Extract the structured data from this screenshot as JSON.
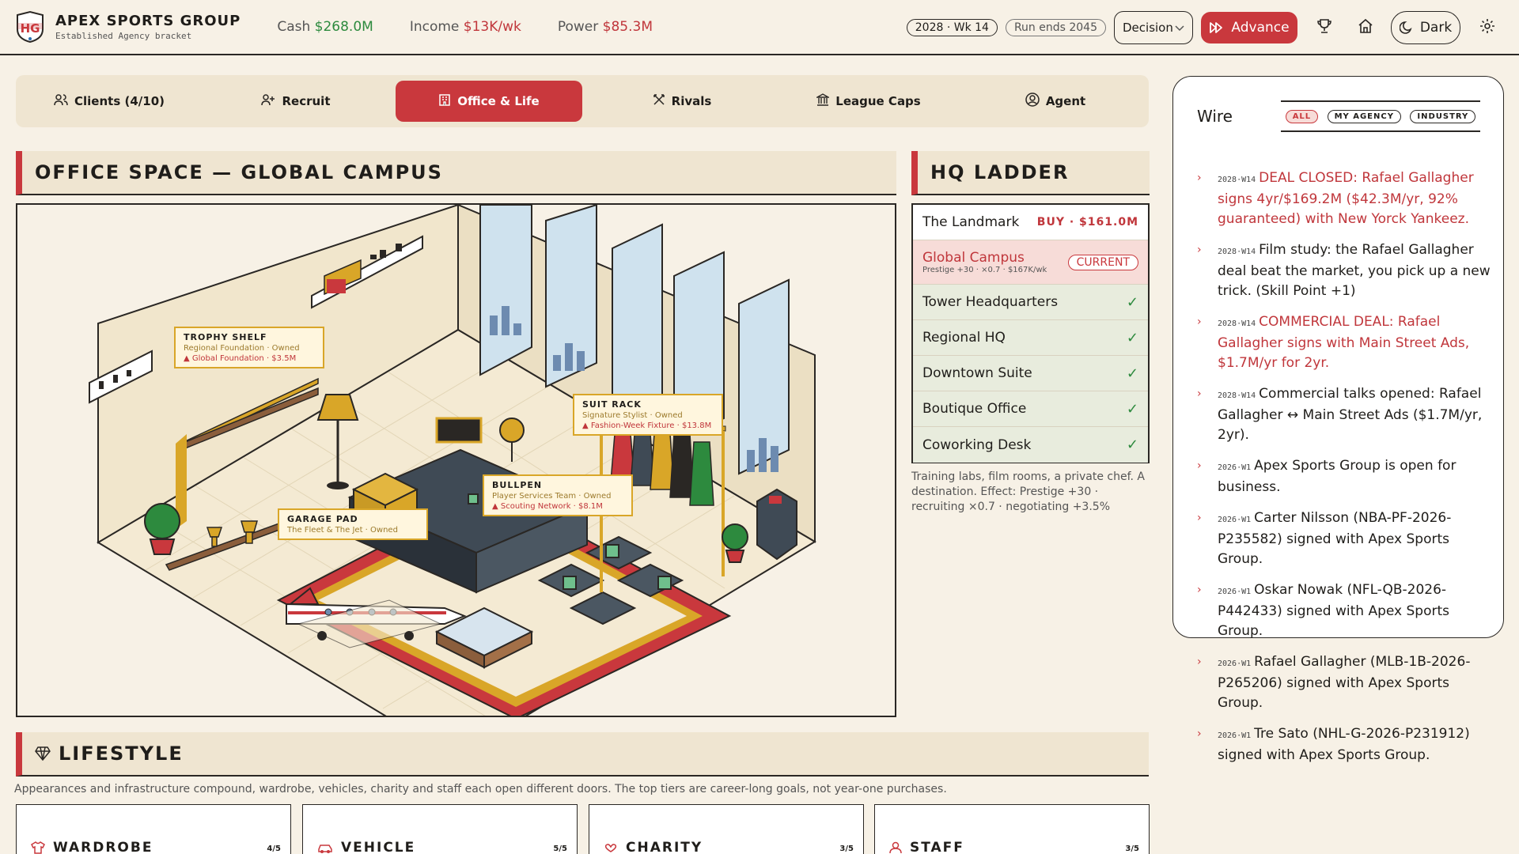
{
  "header": {
    "brand_name": "APEX SPORTS GROUP",
    "brand_sub": "Established Agency bracket",
    "logo_text": "HG",
    "cash_label": "Cash",
    "cash_value": "$268.0M",
    "income_label": "Income",
    "income_value": "$13K/wk",
    "power_label": "Power",
    "power_value": "$85.3M",
    "week": "2028 · Wk 14",
    "run_ends": "Run ends 2045",
    "mode_select": "Decision",
    "advance_label": "Advance",
    "theme_label": "Dark"
  },
  "tabs": [
    {
      "label": "Clients (4/10)",
      "icon": "users-icon"
    },
    {
      "label": "Recruit",
      "icon": "user-plus-icon"
    },
    {
      "label": "Office & Life",
      "icon": "building-icon",
      "active": true
    },
    {
      "label": "Rivals",
      "icon": "swords-icon"
    },
    {
      "label": "League Caps",
      "icon": "bank-icon"
    },
    {
      "label": "Agent",
      "icon": "user-circle-icon"
    }
  ],
  "office": {
    "title": "OFFICE SPACE — GLOBAL CAMPUS",
    "labels": {
      "trophy": {
        "title": "TROPHY SHELF",
        "status": "Regional Foundation · Owned",
        "next": "▲ Global Foundation · $3.5M"
      },
      "suit": {
        "title": "SUIT RACK",
        "status": "Signature Stylist · Owned",
        "next": "▲ Fashion-Week Fixture · $13.8M"
      },
      "bullpen": {
        "title": "BULLPEN",
        "status": "Player Services Team · Owned",
        "next": "▲ Scouting Network · $8.1M"
      },
      "garage": {
        "title": "GARAGE PAD",
        "status": "The Fleet & The Jet · Owned"
      }
    }
  },
  "hq": {
    "title": "HQ LADDER",
    "rows": [
      {
        "name": "The Landmark",
        "badge": "BUY · $161.0M"
      },
      {
        "name": "Global Campus",
        "sub": "Prestige +30 · ×0.7 · $167K/wk",
        "badge": "CURRENT"
      },
      {
        "name": "Tower Headquarters"
      },
      {
        "name": "Regional HQ"
      },
      {
        "name": "Downtown Suite"
      },
      {
        "name": "Boutique Office"
      },
      {
        "name": "Coworking Desk"
      }
    ],
    "note": "Training labs, film rooms, a private chef. A destination. Effect: Prestige +30 · recruiting ×0.7 · negotiating +3.5%"
  },
  "wire": {
    "title": "Wire",
    "filters": [
      "ALL",
      "MY AGENCY",
      "INDUSTRY"
    ],
    "items": [
      {
        "date": "2028·W14",
        "text": "DEAL CLOSED: Rafael Gallagher signs 4yr/$169.2M ($42.3M/yr, 92% guaranteed) with New Yorck Yankeez.",
        "hl": true
      },
      {
        "date": "2028·W14",
        "text": "Film study: the Rafael Gallagher deal beat the market, you pick up a new trick. (Skill Point +1)",
        "hl": false
      },
      {
        "date": "2028·W14",
        "text": "COMMERCIAL DEAL: Rafael Gallagher signs with Main Street Ads, $1.7M/yr for 2yr.",
        "hl": true
      },
      {
        "date": "2028·W14",
        "text": "Commercial talks opened: Rafael Gallagher ↔ Main Street Ads ($1.7M/yr, 2yr).",
        "hl": false
      },
      {
        "date": "2026·W1",
        "text": "Apex Sports Group is open for business.",
        "hl": false
      },
      {
        "date": "2026·W1",
        "text": "Carter Nilsson (NBA-PF-2026-P235582) signed with Apex Sports Group.",
        "hl": false
      },
      {
        "date": "2026·W1",
        "text": "Oskar Nowak (NFL-QB-2026-P442433) signed with Apex Sports Group.",
        "hl": false
      },
      {
        "date": "2026·W1",
        "text": "Rafael Gallagher (MLB-1B-2026-P265206) signed with Apex Sports Group.",
        "hl": false
      },
      {
        "date": "2026·W1",
        "text": "Tre Sato (NHL-G-2026-P231912) signed with Apex Sports Group.",
        "hl": false
      }
    ]
  },
  "lifestyle": {
    "title": "LIFESTYLE",
    "note": "Appearances and infrastructure compound, wardrobe, vehicles, charity and staff each open different doors. The top tiers are career-long goals, not year-one purchases.",
    "cards": [
      {
        "title": "WARDROBE",
        "count": "4/5"
      },
      {
        "title": "VEHICLE",
        "count": "5/5"
      },
      {
        "title": "CHARITY",
        "count": "3/5"
      },
      {
        "title": "STAFF",
        "count": "3/5"
      }
    ]
  },
  "colors": {
    "accent": "#c9383d",
    "ink": "#2a2724",
    "bg": "#f7f1e6",
    "gold": "#d9a628",
    "green": "#2d8a3e"
  }
}
